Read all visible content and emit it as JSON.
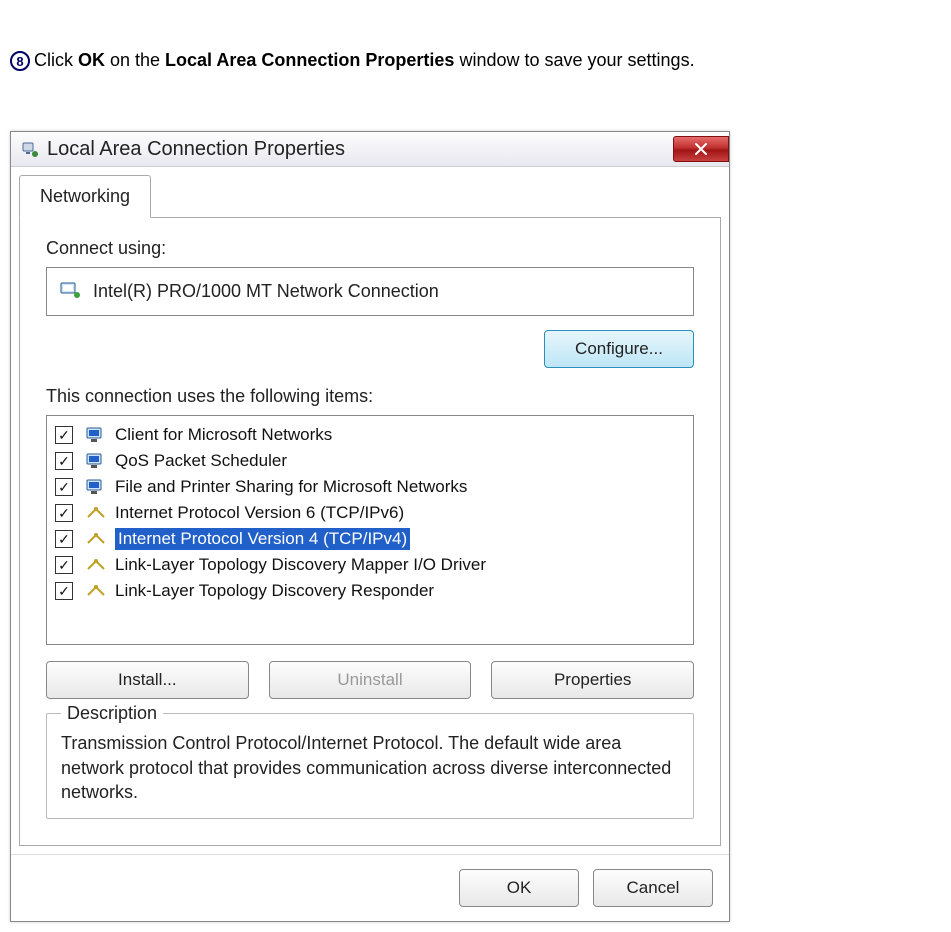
{
  "instruction": {
    "step_number": "8",
    "pre": "Click ",
    "bold1": "OK",
    "mid": " on the ",
    "bold2": "Local Area Connection Properties",
    "post": " window to save your settings."
  },
  "dialog": {
    "title": "Local Area Connection Properties",
    "tab": "Networking",
    "connect_using_label": "Connect using:",
    "adapter": "Intel(R) PRO/1000 MT Network Connection",
    "configure_btn": "Configure...",
    "items_label": "This connection uses the following items:",
    "items": [
      {
        "label": "Client for Microsoft Networks",
        "checked": true,
        "icon": "monitor",
        "selected": false
      },
      {
        "label": "QoS Packet Scheduler",
        "checked": true,
        "icon": "monitor",
        "selected": false
      },
      {
        "label": "File and Printer Sharing for Microsoft Networks",
        "checked": true,
        "icon": "monitor",
        "selected": false
      },
      {
        "label": "Internet Protocol Version 6 (TCP/IPv6)",
        "checked": true,
        "icon": "protocol",
        "selected": false
      },
      {
        "label": "Internet Protocol Version 4 (TCP/IPv4)",
        "checked": true,
        "icon": "protocol",
        "selected": true
      },
      {
        "label": "Link-Layer Topology Discovery Mapper I/O Driver",
        "checked": true,
        "icon": "protocol",
        "selected": false
      },
      {
        "label": "Link-Layer Topology Discovery Responder",
        "checked": true,
        "icon": "protocol",
        "selected": false
      }
    ],
    "install_btn": "Install...",
    "uninstall_btn": "Uninstall",
    "properties_btn": "Properties",
    "description_label": "Description",
    "description_text": "Transmission Control Protocol/Internet Protocol. The default wide area network protocol that provides communication across diverse interconnected networks.",
    "ok_btn": "OK",
    "cancel_btn": "Cancel"
  }
}
